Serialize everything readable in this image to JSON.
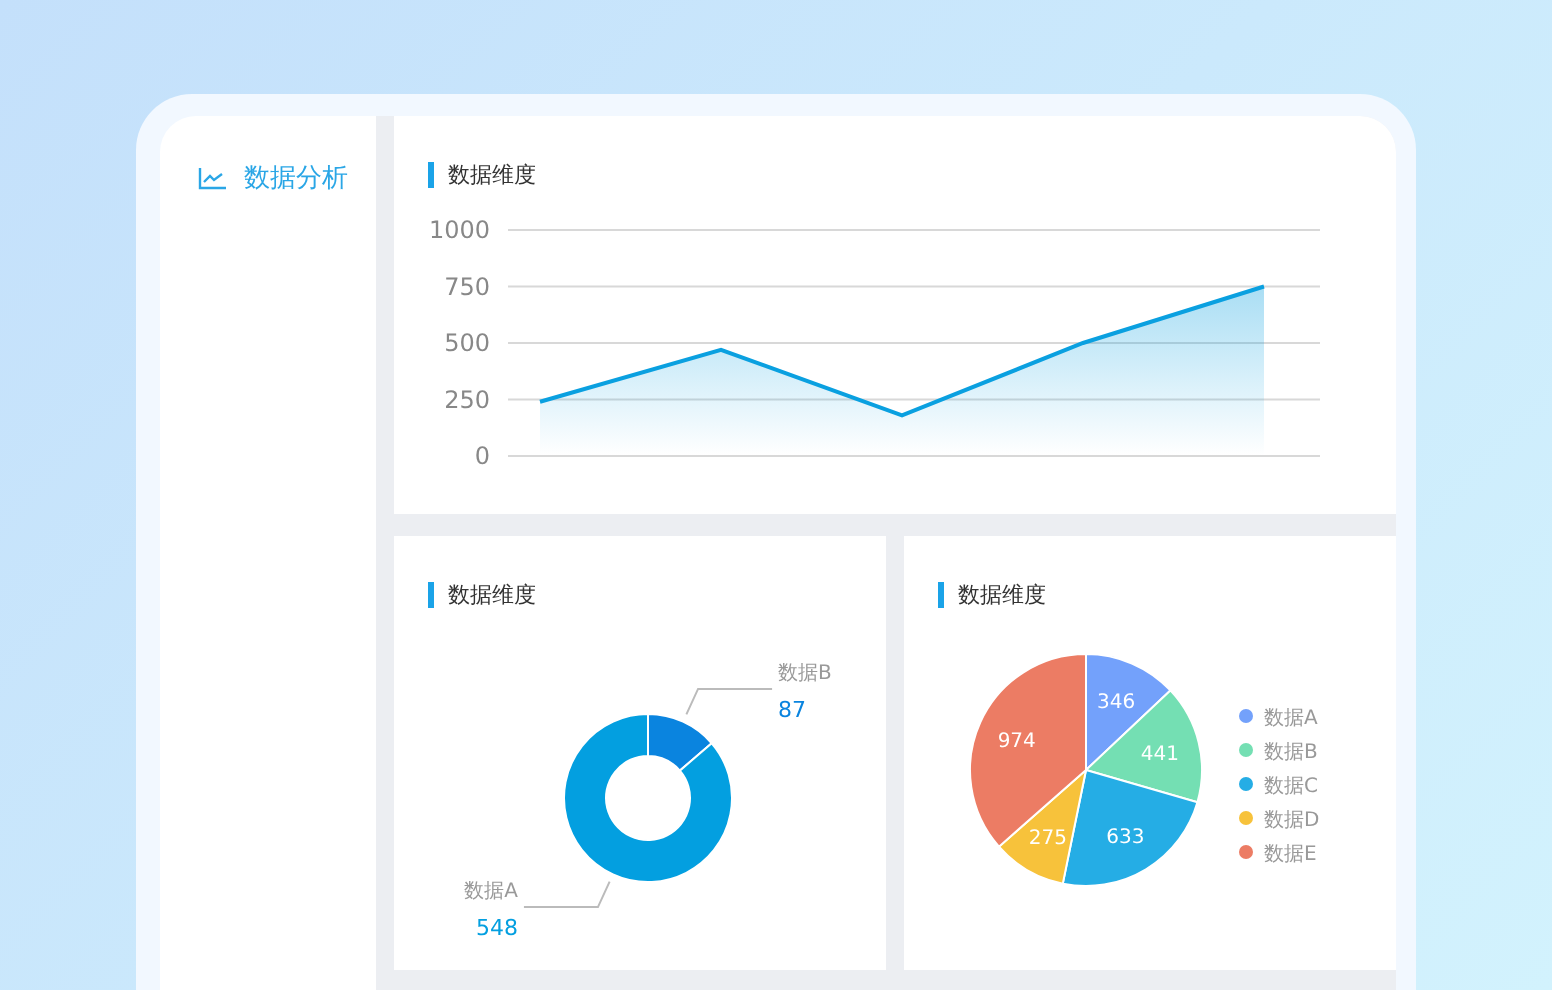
{
  "sidebar": {
    "items": [
      {
        "label": "数据分析",
        "selected": true
      }
    ]
  },
  "line_panel": {
    "chart_data": {
      "type": "area",
      "title": "数据维度",
      "values": [
        240,
        470,
        180,
        500,
        750
      ],
      "ylim": [
        0,
        1000
      ],
      "grid": true,
      "yticks": [
        0,
        250,
        500,
        750,
        1000
      ]
    }
  },
  "donut_panel": {
    "chart_data": {
      "type": "donut",
      "title": "数据维度",
      "categories": [
        "数据B",
        "数据A"
      ],
      "values": [
        87,
        548
      ],
      "data_labels": true,
      "colors": [
        "#0a84df",
        "#039fe0"
      ]
    }
  },
  "pie_panel": {
    "chart_data": {
      "type": "pie",
      "title": "数据维度",
      "categories": [
        "数据A",
        "数据B",
        "数据C",
        "数据D",
        "数据E"
      ],
      "values": [
        346,
        441,
        633,
        275,
        974
      ],
      "data_labels": true,
      "legend": "right",
      "colors": [
        "#73a1fb",
        "#74dfb3",
        "#25ade5",
        "#f7c23b",
        "#ec7c64"
      ]
    }
  }
}
